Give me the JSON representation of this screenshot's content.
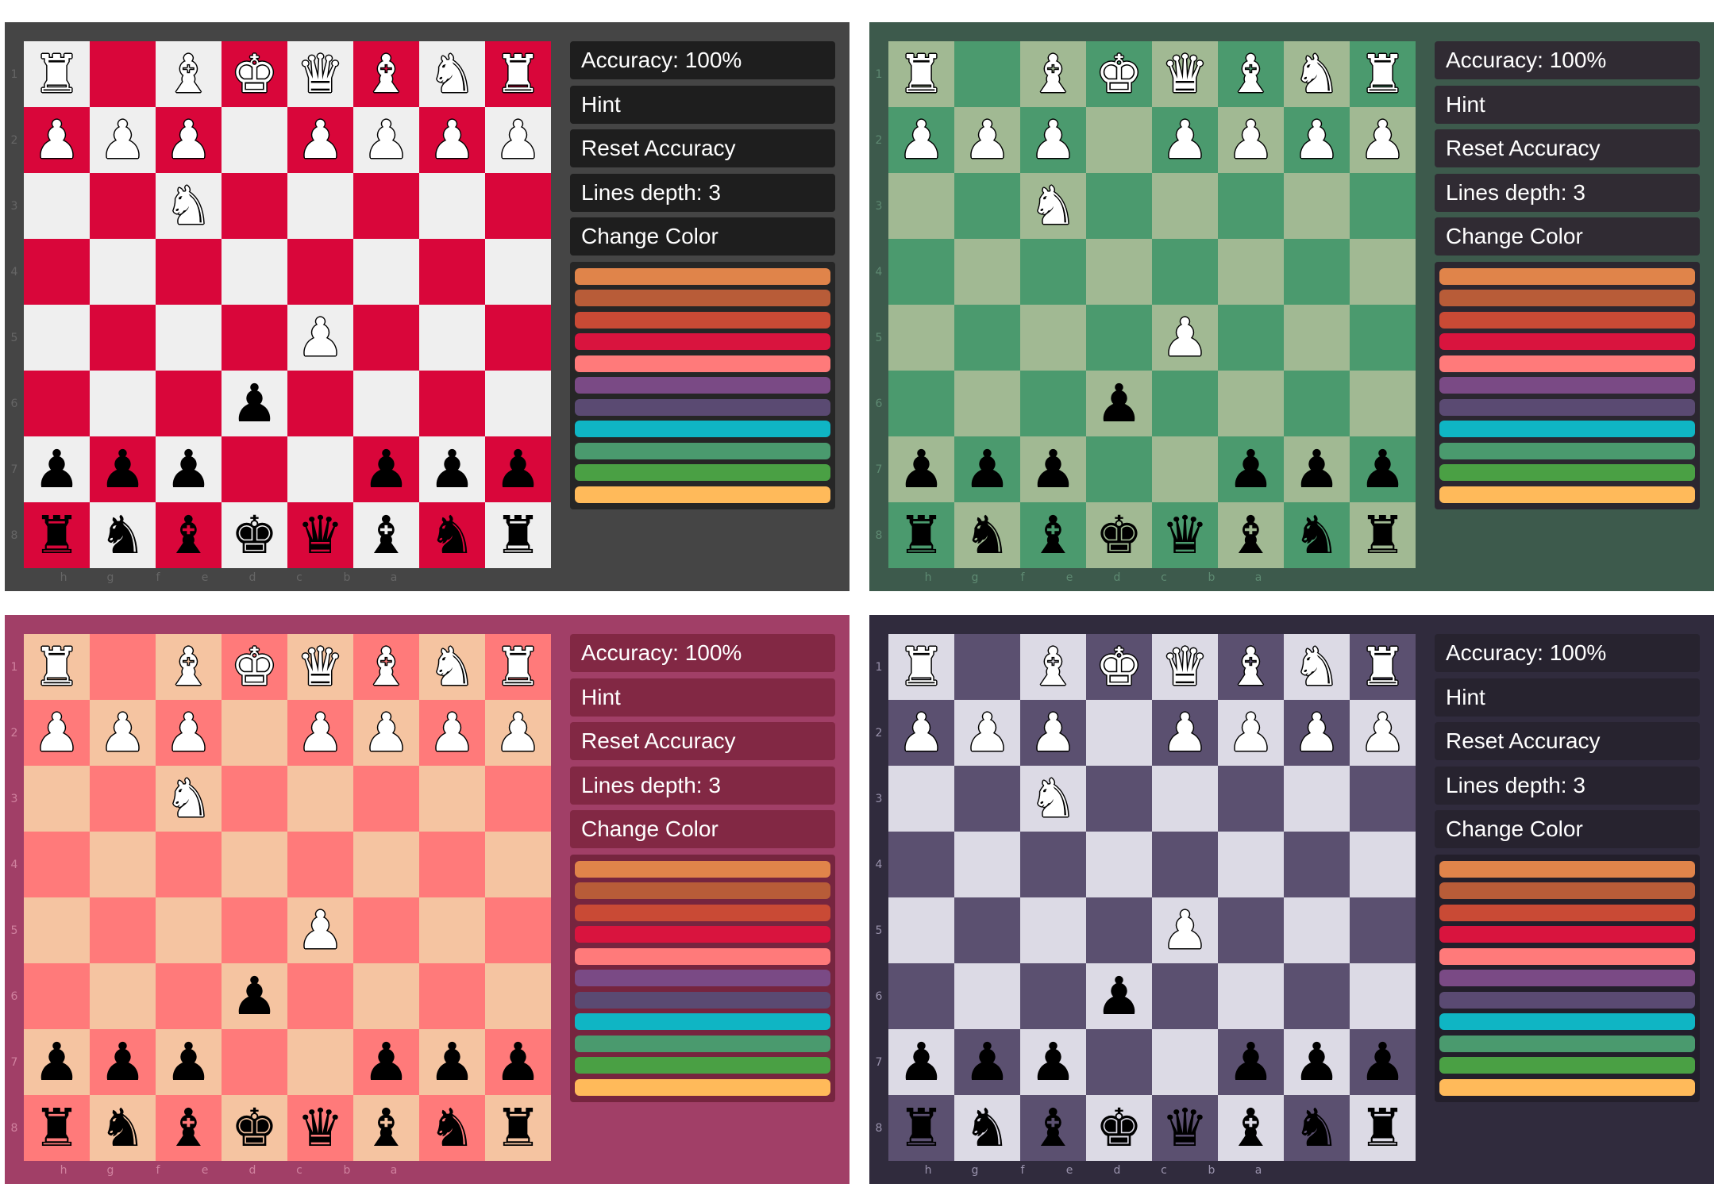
{
  "controls": {
    "accuracy": "Accuracy: 100%",
    "hint": "Hint",
    "reset": "Reset Accuracy",
    "depth": "Lines depth: 3",
    "change_color": "Change Color"
  },
  "ranks": [
    "1",
    "2",
    "3",
    "4",
    "5",
    "6",
    "7",
    "8"
  ],
  "files": [
    "h",
    "g",
    "f",
    "e",
    "d",
    "c",
    "b",
    "a"
  ],
  "board": [
    [
      "wR",
      "",
      "wB",
      "wK",
      "wQ",
      "wB",
      "wN",
      "wR"
    ],
    [
      "wP",
      "wP",
      "wP",
      "",
      "wP",
      "wP",
      "wP",
      "wP"
    ],
    [
      "",
      "",
      "wN",
      "",
      "",
      "",
      "",
      ""
    ],
    [
      "",
      "",
      "",
      "",
      "",
      "",
      "",
      ""
    ],
    [
      "",
      "",
      "",
      "",
      "wP",
      "",
      "",
      ""
    ],
    [
      "",
      "",
      "",
      "bP",
      "",
      "",
      "",
      ""
    ],
    [
      "bP",
      "bP",
      "bP",
      "",
      "",
      "bP",
      "bP",
      "bP"
    ],
    [
      "bR",
      "bN",
      "bB",
      "bK",
      "bQ",
      "bB",
      "bN",
      "bR"
    ]
  ],
  "piece_glyphs": {
    "K": "♚",
    "Q": "♛",
    "R": "♜",
    "B": "♝",
    "N": "♞",
    "P": "♟"
  },
  "palette": [
    "#e0844a",
    "#b85c38",
    "#c94a35",
    "#d9143e",
    "#ff7a7a",
    "#7a4a85",
    "#5a4a72",
    "#0fb5c4",
    "#4a9a6e",
    "#4aa044",
    "#ffba5a"
  ],
  "themes": [
    {
      "id": "red",
      "panel_bg": "#454545",
      "light": "#efefef",
      "dark": "#d9063a",
      "button_bg": "#1e1e1e",
      "swatch_bg": "#262626",
      "label_color": "#666666"
    },
    {
      "id": "green",
      "panel_bg": "#3d5a4c",
      "light": "#a1b993",
      "dark": "#4b9a6e",
      "button_bg": "#302b33",
      "swatch_bg": "#2b2730",
      "label_color": "#5e8a72"
    },
    {
      "id": "pink",
      "panel_bg": "#a13f67",
      "light": "#f5c4a1",
      "dark": "#ff7a7a",
      "button_bg": "#822844",
      "swatch_bg": "#76253f",
      "label_color": "#d0829f"
    },
    {
      "id": "purple",
      "panel_bg": "#302b3d",
      "light": "#dcdae5",
      "dark": "#5b5070",
      "button_bg": "#27232f",
      "swatch_bg": "#231f2b",
      "label_color": "#9a93ad"
    }
  ]
}
